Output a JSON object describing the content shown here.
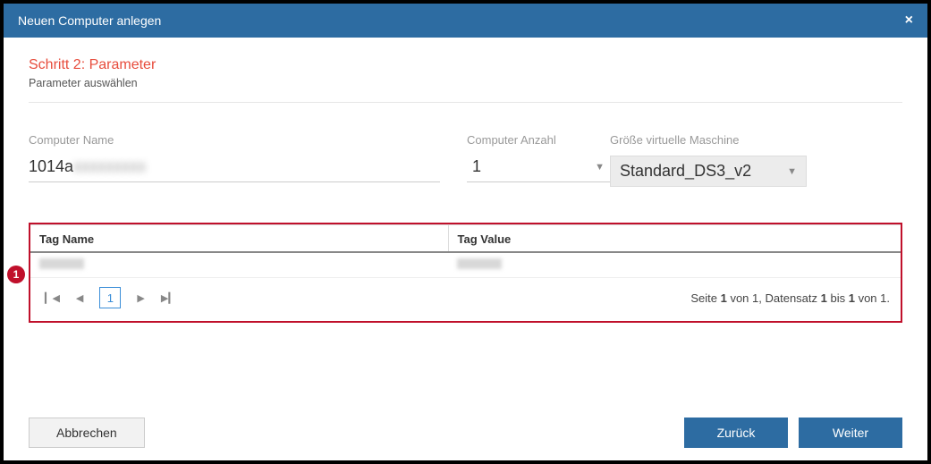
{
  "header": {
    "title": "Neuen Computer anlegen",
    "close": "×"
  },
  "step": {
    "title": "Schritt 2: Parameter",
    "subtitle": "Parameter auswählen"
  },
  "fields": {
    "name_label": "Computer Name",
    "name_value_prefix": "1014a",
    "count_label": "Computer Anzahl",
    "count_value": "1",
    "size_label": "Größe virtuelle Maschine",
    "size_value": "Standard_DS3_v2"
  },
  "annotation": {
    "badge": "1"
  },
  "table": {
    "col_name": "Tag Name",
    "col_value": "Tag Value"
  },
  "pager": {
    "current": "1",
    "info_prefix": "Seite ",
    "info_mid1": " von ",
    "info_total_pages": "1",
    "info_mid2": ", Datensatz ",
    "info_from": "1",
    "info_mid3": " bis ",
    "info_to": "1",
    "info_mid4": " von ",
    "info_total_rows": "1",
    "info_suffix": "."
  },
  "buttons": {
    "cancel": "Abbrechen",
    "back": "Zurück",
    "next": "Weiter"
  }
}
